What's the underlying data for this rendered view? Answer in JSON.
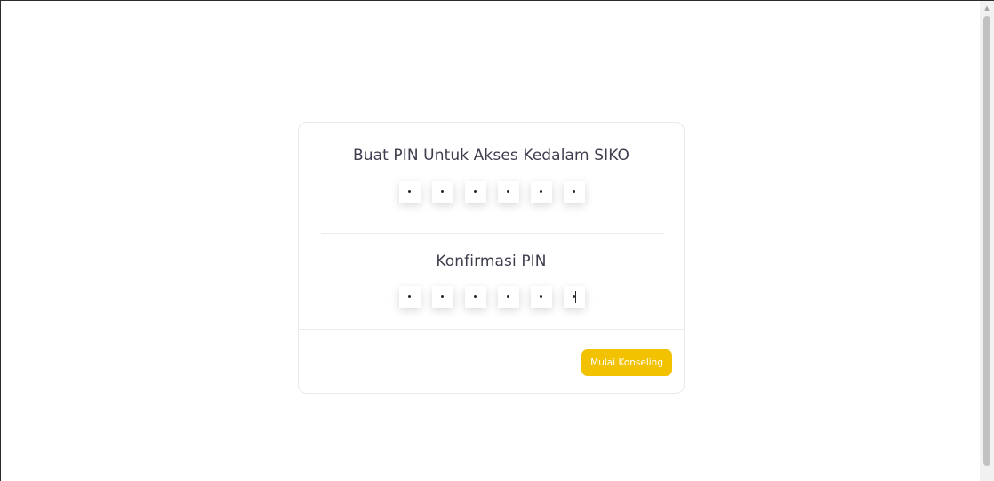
{
  "pin_setup": {
    "create_title": "Buat PIN Untuk Akses Kedalam SIKO",
    "create_pin_length": 6,
    "create_pin_filled": 6,
    "confirm_title": "Konfirmasi PIN",
    "confirm_pin_length": 6,
    "confirm_pin_filled": 6,
    "submit_label": "Mulai Konseling"
  },
  "colors": {
    "accent": "#f2c100",
    "title_text": "#3d3d4e",
    "divider": "#ececf0"
  }
}
